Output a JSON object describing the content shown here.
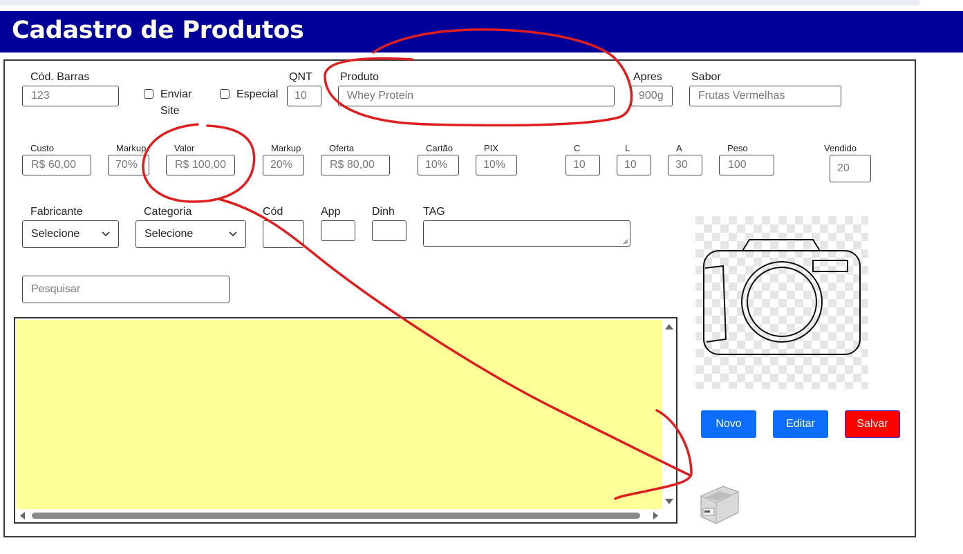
{
  "title": "Cadastro de Produtos",
  "row1": {
    "cod_barras": {
      "label": "Cód. Barras",
      "value": "123"
    },
    "enviar_site": {
      "label_line1": "Enviar",
      "label_line2": "Site"
    },
    "especial": {
      "label": "Especial"
    },
    "qnt": {
      "label": "QNT",
      "value": "10"
    },
    "produto": {
      "label": "Produto",
      "value": "Whey Protein"
    },
    "apres": {
      "label": "Apres",
      "value": "900g"
    },
    "sabor": {
      "label": "Sabor",
      "value": "Frutas Vermelhas"
    }
  },
  "row2": {
    "custo": {
      "label": "Custo",
      "value": "R$ 60,00"
    },
    "markup1": {
      "label": "Markup",
      "value": "70%"
    },
    "valor": {
      "label": "Valor",
      "value": "R$ 100,00"
    },
    "markup2": {
      "label": "Markup",
      "value": "20%"
    },
    "oferta": {
      "label": "Oferta",
      "value": "R$ 80,00"
    },
    "cartao": {
      "label": "Cartão",
      "value": "10%"
    },
    "pix": {
      "label": "PIX",
      "value": "10%"
    },
    "c": {
      "label": "C",
      "value": "10"
    },
    "l": {
      "label": "L",
      "value": "10"
    },
    "a": {
      "label": "A",
      "value": "30"
    },
    "peso": {
      "label": "Peso",
      "value": "100"
    },
    "vendido": {
      "label": "Vendido",
      "value": "20"
    }
  },
  "row3": {
    "fabricante": {
      "label": "Fabricante",
      "value": "Selecione"
    },
    "categoria": {
      "label": "Categoria",
      "value": "Selecione"
    },
    "cod": {
      "label": "Cód"
    },
    "app": {
      "label": "App"
    },
    "dinh": {
      "label": "Dinh"
    },
    "tag": {
      "label": "TAG"
    }
  },
  "search": {
    "placeholder": "Pesquisar"
  },
  "buttons": {
    "novo": "Novo",
    "editar": "Editar",
    "salvar": "Salvar"
  },
  "colors": {
    "title_bg": "#000099",
    "grid_bg": "#ffff99",
    "btn_blue": "#0d6efd",
    "btn_red": "#ff0000",
    "annotation_red": "#dd1f1f"
  },
  "icons": {
    "image_placeholder": "camera-icon",
    "printer": "printer-icon"
  }
}
